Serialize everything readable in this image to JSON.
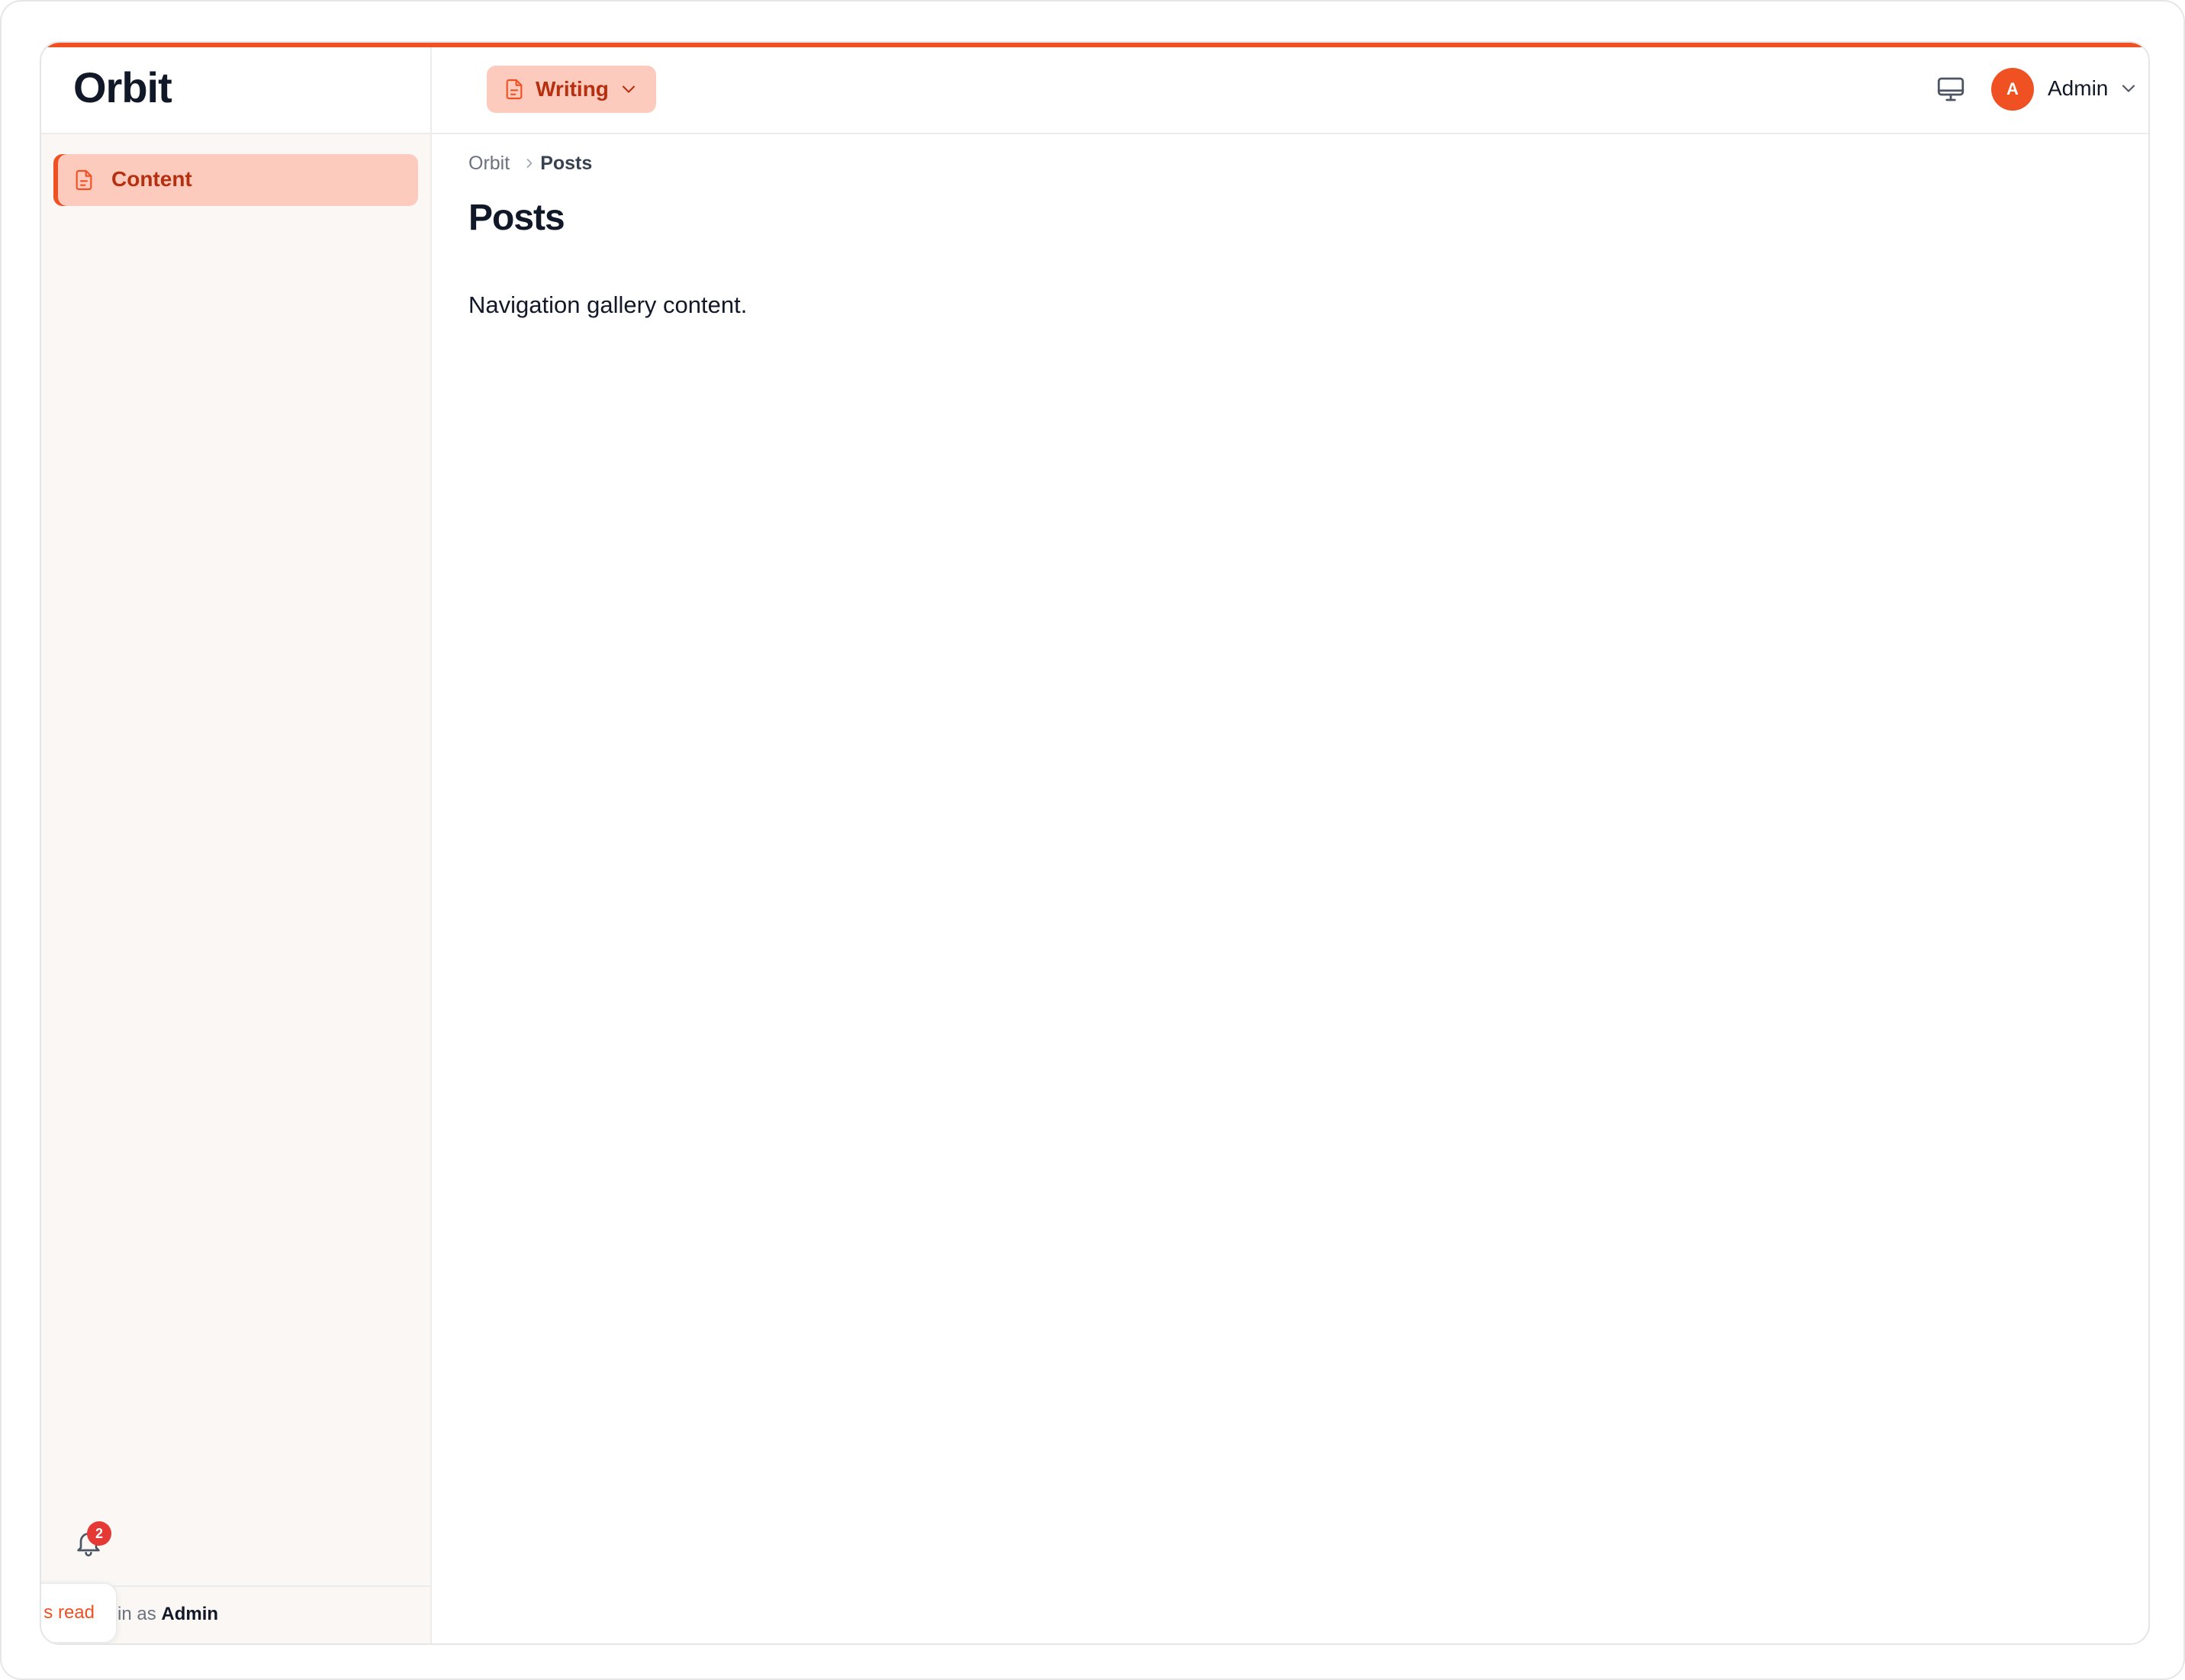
{
  "brand": {
    "name": "Orbit"
  },
  "sidebar": {
    "items": [
      {
        "label": "Content",
        "icon": "document-icon",
        "active": true
      }
    ],
    "notifications": {
      "count": "2",
      "icon": "bell-icon"
    },
    "footer": {
      "prefix": "d in as",
      "user": "Admin"
    },
    "toast": {
      "action_label": "s read"
    }
  },
  "header": {
    "workspace": {
      "label": "Writing",
      "icon": "document-icon"
    },
    "display_icon": "monitor-icon",
    "user": {
      "initial": "A",
      "name": "Admin"
    }
  },
  "breadcrumb": {
    "root": "Orbit",
    "current": "Posts"
  },
  "page": {
    "title": "Posts",
    "body": "Navigation gallery content."
  },
  "colors": {
    "accent": "#ef5122",
    "accent_soft": "#fccbbe",
    "accent_text": "#b5300f",
    "sidebar_bg": "#faf7f4",
    "badge": "#e53935",
    "text": "#111827"
  }
}
